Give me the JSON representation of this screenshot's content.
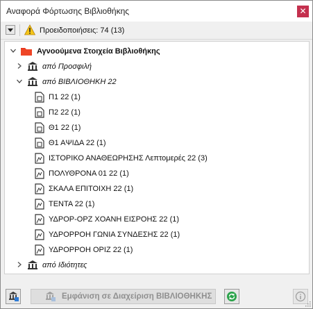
{
  "window": {
    "title": "Αναφορά Φόρτωσης Βιβλιοθήκης"
  },
  "toolbar": {
    "warnings_text": "Προειδοποιήσεις: 74 (13)"
  },
  "tree": {
    "root_label": "Αγνοούμενα Στοιχεία Βιβλιοθήκης",
    "groups": [
      {
        "label": "από Προσφιλή",
        "expanded": false
      },
      {
        "label": "από ΒΙΒΛΙΟΘΗΚΗ 22",
        "expanded": true
      },
      {
        "label": "από Ιδιότητες",
        "expanded": false
      }
    ],
    "items": [
      {
        "label": "Π1 22 (1)",
        "icon": "document-icon"
      },
      {
        "label": "Π2 22 (1)",
        "icon": "document-icon"
      },
      {
        "label": "Θ1 22 (1)",
        "icon": "document-icon"
      },
      {
        "label": "Θ1 ΑΨΙΔΑ 22 (1)",
        "icon": "document-icon"
      },
      {
        "label": "ΙΣΤΟΡΙΚΟ ΑΝΑΘΕΩΡΗΣΗΣ Λεπτομερές 22 (3)",
        "icon": "object-icon"
      },
      {
        "label": "ΠΟΛΥΘΡΟΝΑ 01 22 (1)",
        "icon": "object-icon"
      },
      {
        "label": "ΣΚΑΛΑ ΕΠΙΤΟΙΧΗ 22 (1)",
        "icon": "object-icon"
      },
      {
        "label": "ΤΕΝΤΑ 22 (1)",
        "icon": "object-icon"
      },
      {
        "label": "ΥΔΡΟΡ-ΟΡΖ ΧΟΑΝΗ ΕΙΣΡΟΗΣ 22 (1)",
        "icon": "object-icon"
      },
      {
        "label": "ΥΔΡΟΡΡΟΗ ΓΩΝΙΑ ΣΥΝΔΕΣΗΣ 22 (1)",
        "icon": "object-icon"
      },
      {
        "label": "ΥΔΡΟΡΡΟΗ ΟΡΙΖ 22 (1)",
        "icon": "object-icon"
      }
    ]
  },
  "bottombar": {
    "show_button_label": "Εμφάνιση σε Διαχείριση ΒΙΒΛΙΟΘΗΚΗΣ"
  },
  "colors": {
    "close": "#c4304e",
    "folder": "#e8381f",
    "refresh": "#2aa34a"
  }
}
